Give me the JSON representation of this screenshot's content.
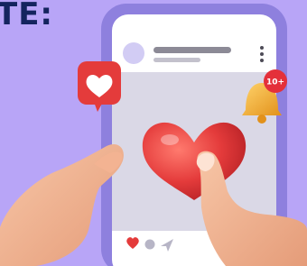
{
  "headline": "TE:",
  "notification": {
    "count": "10+"
  },
  "colors": {
    "background": "#b8a5f7",
    "headline": "#14245e",
    "phone_frame": "#8e80de",
    "heart": "#e43b3b",
    "bell": "#f5a623",
    "badge": "#e4303a"
  },
  "icons": [
    "heart-icon",
    "bell-icon",
    "comment-icon",
    "share-icon",
    "more-vertical-icon"
  ]
}
